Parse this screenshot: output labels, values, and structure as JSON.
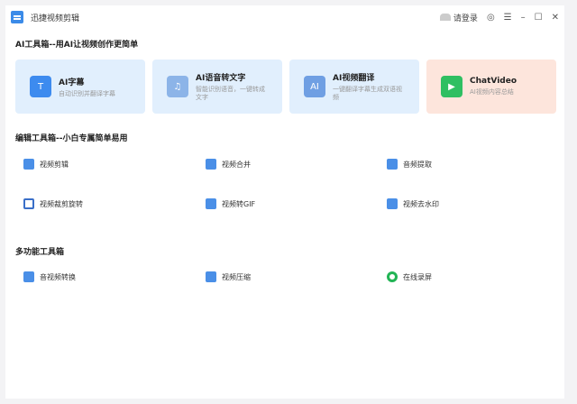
{
  "app": {
    "title": "迅捷视频剪辑",
    "login": "请登录"
  },
  "sections": {
    "ai": "AI工具箱--用AI让视频创作更简单",
    "edit": "编辑工具箱--小白专属简单易用",
    "multi": "多功能工具箱"
  },
  "ai_cards": [
    {
      "title": "AI字幕",
      "desc": "自动识别并翻译字幕",
      "icon": "T"
    },
    {
      "title": "AI语音转文字",
      "desc": "智能识别语音，一键转成文字",
      "icon": "♫"
    },
    {
      "title": "AI视频翻译",
      "desc": "一键翻译字幕生成双语视频",
      "icon": "AI"
    },
    {
      "title": "ChatVideo",
      "desc": "AI视频内容总结",
      "icon": "▶"
    }
  ],
  "edit_tools": [
    "视频剪辑",
    "视频合并",
    "音频提取",
    "视频裁剪旋转",
    "视频转GIF",
    "视频去水印"
  ],
  "multi_tools": [
    "音视频转换",
    "视频压缩",
    "在线录屏"
  ]
}
